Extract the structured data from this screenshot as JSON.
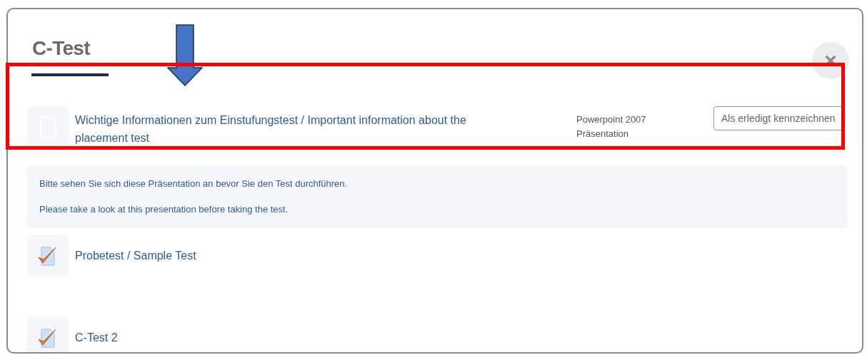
{
  "dialog": {
    "title": "C-Test",
    "close": "×"
  },
  "items": [
    {
      "kind": "presentation",
      "title": "Wichtige Informationen zum Einstufungstest / Important information about the placement test",
      "type": "Powerpoint 2007 Präsentation",
      "action": "Als erledigt kennzeichnen",
      "description": [
        "Bitte sehen Sie sich diese Präsentation an bevor Sie den Test durchführen.",
        "Please take a look at this presentation before taking the test."
      ]
    },
    {
      "kind": "quiz",
      "title": "Probetest / Sample Test"
    },
    {
      "kind": "quiz",
      "title": "C-Test 2"
    }
  ],
  "annotations": [
    {
      "kind": "arrow"
    },
    {
      "kind": "frame"
    }
  ]
}
